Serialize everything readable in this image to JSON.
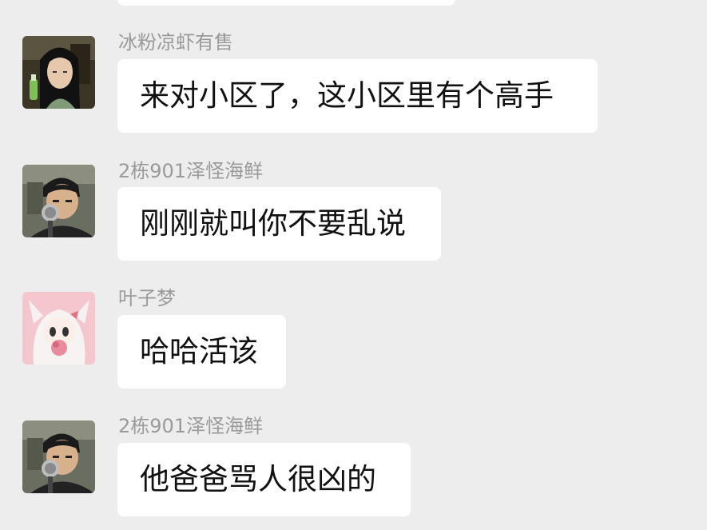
{
  "messages": [
    {
      "sender": "冰粉凉虾有售",
      "text": "来对小区了，这小区里有个高手",
      "avatar_icon": "anime-girl-black-hair-avatar"
    },
    {
      "sender": "2栋901泽怪海鲜",
      "text": "刚刚就叫你不要乱说",
      "avatar_icon": "man-with-microphone-avatar"
    },
    {
      "sender": "叶子梦",
      "text": "哈哈活该",
      "avatar_icon": "white-hair-chibi-girl-avatar"
    },
    {
      "sender": "2栋901泽怪海鲜",
      "text": "他爸爸骂人很凶的",
      "avatar_icon": "man-with-microphone-avatar"
    }
  ],
  "colors": {
    "background": "#ededed",
    "bubble": "#ffffff",
    "sender_text": "#9a9a9a",
    "message_text": "#111111"
  }
}
